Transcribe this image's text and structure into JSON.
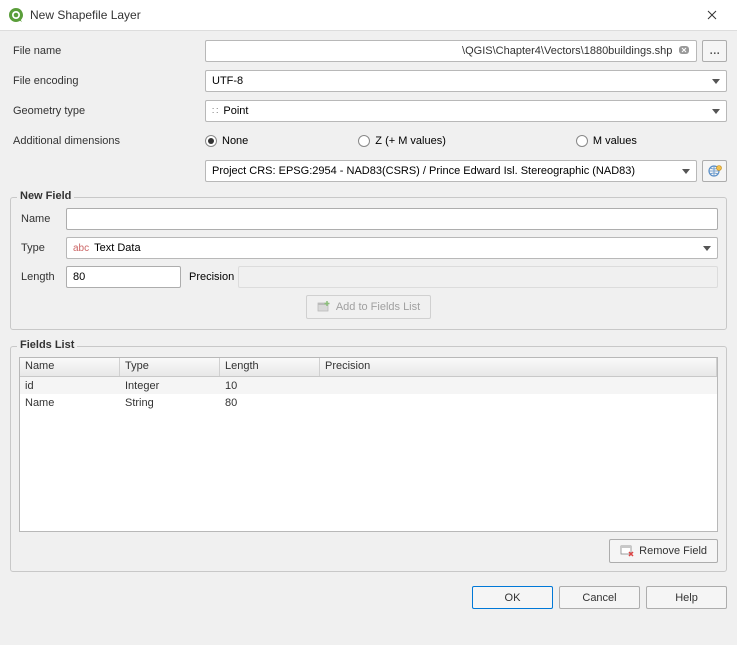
{
  "window": {
    "title": "New Shapefile Layer"
  },
  "form": {
    "file_name_label": "File name",
    "file_name_value": "\\QGIS\\Chapter4\\Vectors\\1880buildings.shp",
    "browse_label": "…",
    "file_encoding_label": "File encoding",
    "file_encoding_value": "UTF-8",
    "geometry_type_label": "Geometry type",
    "geometry_type_value": "Point",
    "additional_dims_label": "Additional dimensions",
    "dims": {
      "none": "None",
      "z": "Z (+ M values)",
      "m": "M values",
      "selected": "none"
    },
    "crs_value": "Project CRS: EPSG:2954 - NAD83(CSRS) / Prince Edward Isl. Stereographic (NAD83)"
  },
  "new_field": {
    "group_title": "New Field",
    "name_label": "Name",
    "name_value": "",
    "type_label": "Type",
    "type_prefix": "abc",
    "type_value": "Text Data",
    "length_label": "Length",
    "length_value": "80",
    "precision_label": "Precision",
    "precision_value": "",
    "add_button": "Add to Fields List"
  },
  "fields_list": {
    "group_title": "Fields List",
    "columns": {
      "name": "Name",
      "type": "Type",
      "length": "Length",
      "precision": "Precision"
    },
    "rows": [
      {
        "name": "id",
        "type": "Integer",
        "length": "10",
        "precision": ""
      },
      {
        "name": "Name",
        "type": "String",
        "length": "80",
        "precision": ""
      }
    ],
    "remove_button": "Remove Field"
  },
  "buttons": {
    "ok": "OK",
    "cancel": "Cancel",
    "help": "Help"
  }
}
